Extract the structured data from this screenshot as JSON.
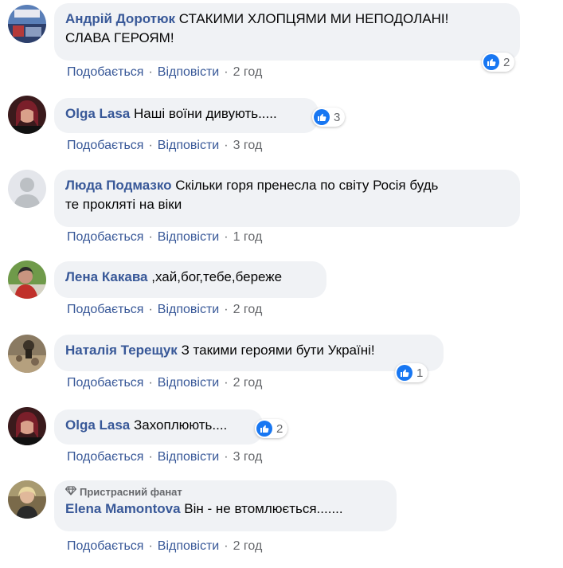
{
  "actions": {
    "like": "Подобається",
    "reply": "Відповісти"
  },
  "comments": [
    {
      "author": "Андрій Доротюк",
      "text": "СТАКИМИ ХЛОПЦЯМИ МИ НЕПОДОЛАНІ! СЛАВА ГЕРОЯМ!",
      "text_line1": "СТАКИМИ ХЛОПЦЯМИ МИ НЕПОДОЛАНІ!",
      "text_line2": "СЛАВА ГЕРОЯМ!",
      "likes": "2",
      "time": "2 год"
    },
    {
      "author": "Olga Lasa",
      "text": "Наші воїни дивують.....",
      "likes": "3",
      "time": "3 год"
    },
    {
      "author": "Люда Подмазко",
      "text": "Скільки горя пренесла по світу Росія будь те прокляті на віки",
      "text_line1": "Скільки горя пренесла по світу Росія будь",
      "text_line2": "те прокляті на віки",
      "time": "1 год"
    },
    {
      "author": "Лена Какава",
      "text": ",хай,бог,тебе,береже",
      "time": "2 год"
    },
    {
      "author": "Наталія Терещук",
      "text": "З такими героями бути Україні!",
      "likes": "1",
      "time": "2 год"
    },
    {
      "author": "Olga Lasa",
      "text": "Захоплюють....",
      "likes": "2",
      "time": "3 год"
    },
    {
      "author": "Elena Mamontova",
      "badge": "Пристрасний фанат",
      "text": "Він - не втомлюється.......",
      "time": "2 год"
    }
  ],
  "colors": {
    "author": "#385898",
    "bubble": "#f0f2f5",
    "like": "#1877f2",
    "meta": "#65676b"
  }
}
